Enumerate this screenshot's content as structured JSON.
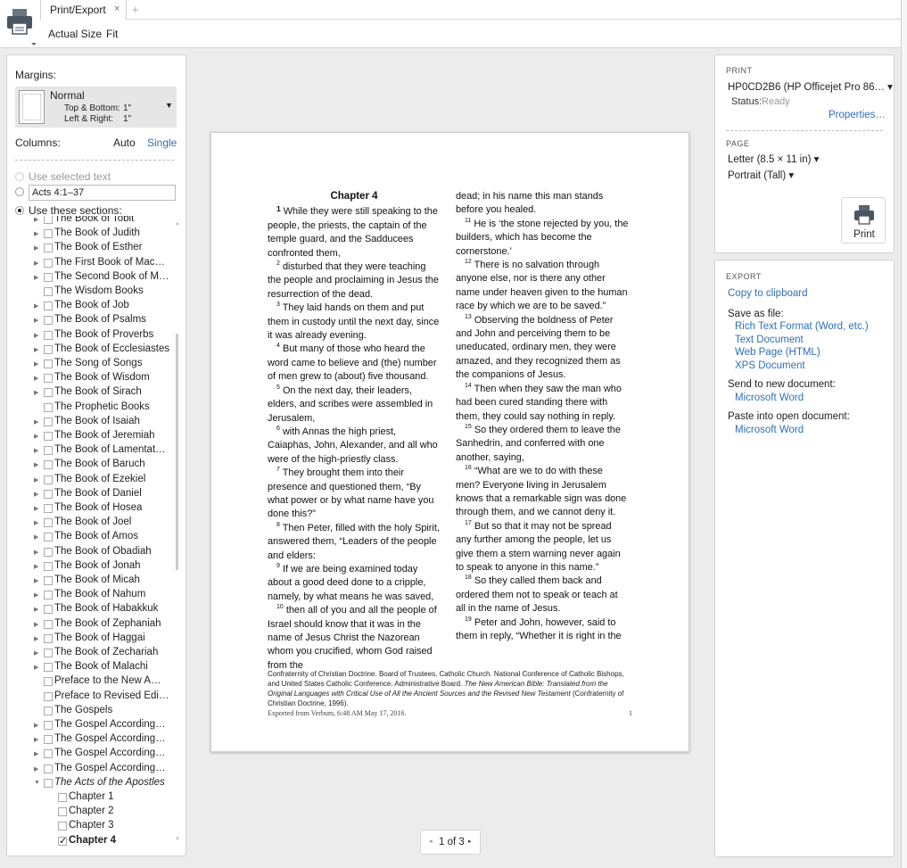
{
  "topbar": {
    "tab_label": "Print/Export",
    "tab_close": "×",
    "tab_add": "+",
    "actual_size": "Actual Size",
    "fit": "Fit"
  },
  "left": {
    "margins_label": "Margins:",
    "margin_name": "Normal",
    "margin_top_bottom_label": "Top & Bottom:",
    "margin_top_bottom_value": "1\"",
    "margin_left_right_label": "Left & Right:",
    "margin_left_right_value": "1\"",
    "columns_label": "Columns:",
    "col_auto": "Auto",
    "col_single": "Single",
    "use_selected": "Use selected text",
    "range_value": "Acts 4:1–37",
    "use_sections": "Use these sections:",
    "tree": [
      {
        "label": "The Book of Tobit",
        "arrow": true,
        "level": 0
      },
      {
        "label": "The Book of Judith",
        "arrow": true,
        "level": 0
      },
      {
        "label": "The Book of Esther",
        "arrow": true,
        "level": 0
      },
      {
        "label": "The First Book of Mac…",
        "arrow": true,
        "level": 0
      },
      {
        "label": "The Second Book of M…",
        "arrow": true,
        "level": 0
      },
      {
        "label": "The Wisdom Books",
        "arrow": false,
        "level": 0
      },
      {
        "label": "The Book of Job",
        "arrow": true,
        "level": 0
      },
      {
        "label": "The Book of Psalms",
        "arrow": true,
        "level": 0
      },
      {
        "label": "The Book of Proverbs",
        "arrow": true,
        "level": 0
      },
      {
        "label": "The Book of Ecclesiastes",
        "arrow": true,
        "level": 0
      },
      {
        "label": "The Song of Songs",
        "arrow": true,
        "level": 0
      },
      {
        "label": "The Book of Wisdom",
        "arrow": true,
        "level": 0
      },
      {
        "label": "The Book of Sirach",
        "arrow": true,
        "level": 0
      },
      {
        "label": "The Prophetic Books",
        "arrow": false,
        "level": 0
      },
      {
        "label": "The Book of Isaiah",
        "arrow": true,
        "level": 0
      },
      {
        "label": "The Book of Jeremiah",
        "arrow": true,
        "level": 0
      },
      {
        "label": "The Book of Lamentat…",
        "arrow": true,
        "level": 0
      },
      {
        "label": "The Book of Baruch",
        "arrow": true,
        "level": 0
      },
      {
        "label": "The Book of Ezekiel",
        "arrow": true,
        "level": 0
      },
      {
        "label": "The Book of Daniel",
        "arrow": true,
        "level": 0
      },
      {
        "label": "The Book of Hosea",
        "arrow": true,
        "level": 0
      },
      {
        "label": "The Book of Joel",
        "arrow": true,
        "level": 0
      },
      {
        "label": "The Book of Amos",
        "arrow": true,
        "level": 0
      },
      {
        "label": "The Book of Obadiah",
        "arrow": true,
        "level": 0
      },
      {
        "label": "The Book of Jonah",
        "arrow": true,
        "level": 0
      },
      {
        "label": "The Book of Micah",
        "arrow": true,
        "level": 0
      },
      {
        "label": "The Book of Nahum",
        "arrow": true,
        "level": 0
      },
      {
        "label": "The Book of Habakkuk",
        "arrow": true,
        "level": 0
      },
      {
        "label": "The Book of Zephaniah",
        "arrow": true,
        "level": 0
      },
      {
        "label": "The Book of Haggai",
        "arrow": true,
        "level": 0
      },
      {
        "label": "The Book of Zechariah",
        "arrow": true,
        "level": 0
      },
      {
        "label": "The Book of Malachi",
        "arrow": true,
        "level": 0
      },
      {
        "label": "Preface to the New A…",
        "arrow": false,
        "level": 0
      },
      {
        "label": "Preface to Revised Edi…",
        "arrow": false,
        "level": 0
      },
      {
        "label": "The Gospels",
        "arrow": false,
        "level": 0
      },
      {
        "label": "The Gospel According…",
        "arrow": true,
        "level": 0
      },
      {
        "label": "The Gospel According…",
        "arrow": true,
        "level": 0
      },
      {
        "label": "The Gospel According…",
        "arrow": true,
        "level": 0
      },
      {
        "label": "The Gospel According…",
        "arrow": true,
        "level": 0
      },
      {
        "label": "The Acts of the Apostles",
        "arrow": true,
        "expanded": true,
        "italic": true,
        "level": 0
      },
      {
        "label": "Chapter 1",
        "arrow": false,
        "level": 1
      },
      {
        "label": "Chapter 2",
        "arrow": false,
        "level": 1
      },
      {
        "label": "Chapter 3",
        "arrow": false,
        "level": 1
      },
      {
        "label": "Chapter 4",
        "arrow": false,
        "level": 1,
        "checked": true,
        "bold": true
      }
    ]
  },
  "doc": {
    "chapter": "Chapter 4",
    "col1": [
      {
        "n": "1",
        "t": "While they were still speaking to the people, the priests, the captain of the temple guard, and the Sadducees confronted them,",
        "first": true
      },
      {
        "n": "2",
        "t": "disturbed that they were teaching the people and proclaiming in Jesus the resurrection of the dead."
      },
      {
        "n": "3",
        "t": "They laid hands on them and put them in custody until the next day, since it was already evening."
      },
      {
        "n": "4",
        "t": "But many of those who heard the word came to believe and (the) number of men grew to (about) five thousand."
      },
      {
        "n": "5",
        "t": "On the next day, their leaders, elders, and scribes were assembled in Jerusalem,"
      },
      {
        "n": "6",
        "t": "with Annas the high priest, Caiaphas, John, Alexander, and all who were of the high-priestly class."
      },
      {
        "n": "7",
        "t": "They brought them into their presence and questioned them, “By what power or by what name have you done this?”"
      },
      {
        "n": "8",
        "t": "Then Peter, filled with the holy Spirit, answered them, “Leaders of the people and elders:"
      },
      {
        "n": "9",
        "t": "If we are being examined today about a good deed done to a cripple, namely, by what means he was saved,"
      },
      {
        "n": "10",
        "t": "then all of you and all the people of Israel should know that it was in the name of Jesus Christ the Nazorean whom you crucified, whom God raised from the"
      }
    ],
    "col2_lead": "dead; in his name this man stands before you healed.",
    "col2": [
      {
        "n": "11",
        "t": "He is ‘the stone rejected by you, the builders, which has become the cornerstone.’"
      },
      {
        "n": "12",
        "t": "There is no salvation through anyone else, nor is there any other name under heaven given to the human race by which we are to be saved.”"
      },
      {
        "n": "13",
        "t": "Observing the boldness of Peter and John and perceiving them to be uneducated, ordinary men, they were amazed, and they recognized them as the companions of Jesus."
      },
      {
        "n": "14",
        "t": "Then when they saw the man who had been cured standing there with them, they could say nothing in reply."
      },
      {
        "n": "15",
        "t": "So they ordered them to leave the Sanhedrin, and conferred with one another, saying,"
      },
      {
        "n": "16",
        "t": "“What are we to do with these men? Everyone living in Jerusalem knows that a remarkable sign was done through them, and we cannot deny it."
      },
      {
        "n": "17",
        "t": "But so that it may not be spread any further among the people, let us give them a stern warning never again to speak to anyone in this name.”"
      },
      {
        "n": "18",
        "t": "So they called them back and ordered them not to speak or teach at all in the name of Jesus."
      },
      {
        "n": "19",
        "t": "Peter and John, however, said to them in reply, “Whether it is right in the"
      }
    ],
    "footnote_a": "Confraternity of Christian Doctrine. Board of Trustees, Catholic Church. National Conference of Catholic Bishops, and United States Catholic Conference. Administrative Board. ",
    "footnote_title": "The New American Bible: Translated from the Original Languages with Critical Use of All the Ancient Sources and the Revised New Testament",
    "footnote_b": " (Confraternity of Christian Doctrine, 1996).",
    "exported": "Exported from Verbum, 6:48 AM May 17, 2016.",
    "page_number": "1"
  },
  "pager": {
    "prev": "◂",
    "text": "1 of 3",
    "next": "▸"
  },
  "print": {
    "section": "PRINT",
    "printer": "HP0CD2B6 (HP Officejet Pro 86… ▾",
    "status_label": "Status:",
    "status_value": "Ready",
    "properties": "Properties…",
    "page_section": "PAGE",
    "paper": "Letter (8.5 × 11 in) ▾",
    "orientation": "Portrait (Tall) ▾",
    "print_button": "Print"
  },
  "export": {
    "section": "EXPORT",
    "copy": "Copy to clipboard",
    "save_as": "Save as file:",
    "rtf": "Rich Text Format (Word, etc.)",
    "text": "Text Document",
    "html": "Web Page (HTML)",
    "xps": "XPS Document",
    "send_new": "Send to new document:",
    "word1": "Microsoft Word",
    "paste_open": "Paste into open document:",
    "word2": "Microsoft Word"
  },
  "colors": {
    "link": "#2f6fb5",
    "panel": "#ffffff",
    "background": "#ececec"
  }
}
